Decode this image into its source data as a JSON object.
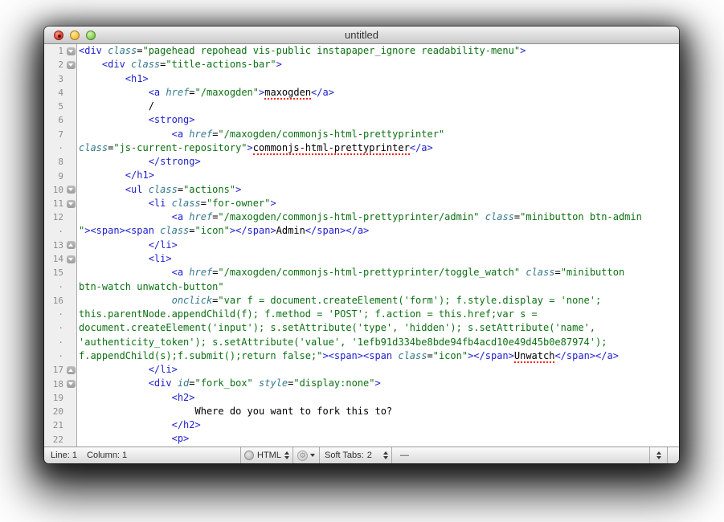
{
  "window": {
    "title": "untitled"
  },
  "colors": {
    "tag": "#1e1ece",
    "attribute": "#36798c",
    "string": "#0d7013",
    "plain": "#000000",
    "misspell_underline": "#ff241c",
    "gutter_number": "#8c8c8c"
  },
  "gutter": {
    "wrap_marker": "·"
  },
  "rows": [
    {
      "num": "1",
      "fold": "down",
      "indent": 0,
      "seg": [
        [
          "t",
          "<div "
        ],
        [
          "a",
          "class"
        ],
        [
          "p",
          "="
        ],
        [
          "s",
          "\"pagehead repohead vis-public instapaper_ignore readability-menu\""
        ],
        [
          "t",
          ">"
        ]
      ]
    },
    {
      "num": "2",
      "fold": "down",
      "indent": 4,
      "seg": [
        [
          "t",
          "<div "
        ],
        [
          "a",
          "class"
        ],
        [
          "p",
          "="
        ],
        [
          "s",
          "\"title-actions-bar\""
        ],
        [
          "t",
          ">"
        ]
      ]
    },
    {
      "num": "3",
      "fold": "",
      "indent": 8,
      "seg": [
        [
          "t",
          "<h1>"
        ]
      ]
    },
    {
      "num": "4",
      "fold": "",
      "indent": 12,
      "seg": [
        [
          "t",
          "<a "
        ],
        [
          "a",
          "href"
        ],
        [
          "p",
          "="
        ],
        [
          "s",
          "\"/maxogden\""
        ],
        [
          "t",
          ">"
        ],
        [
          "m",
          "maxogden"
        ],
        [
          "t",
          "</a>"
        ]
      ]
    },
    {
      "num": "5",
      "fold": "",
      "indent": 12,
      "seg": [
        [
          "p",
          "/"
        ]
      ]
    },
    {
      "num": "6",
      "fold": "",
      "indent": 12,
      "seg": [
        [
          "t",
          "<strong>"
        ]
      ]
    },
    {
      "num": "7",
      "fold": "",
      "indent": 16,
      "seg": [
        [
          "t",
          "<a "
        ],
        [
          "a",
          "href"
        ],
        [
          "p",
          "="
        ],
        [
          "s",
          "\"/maxogden/commonjs-html-prettyprinter\""
        ]
      ]
    },
    {
      "num": "·",
      "fold": "",
      "indent": 0,
      "seg": [
        [
          "a",
          "class"
        ],
        [
          "p",
          "="
        ],
        [
          "s",
          "\"js-current-repository\""
        ],
        [
          "t",
          ">"
        ],
        [
          "m",
          "commonjs-html-prettyprinter"
        ],
        [
          "t",
          "</a>"
        ]
      ]
    },
    {
      "num": "8",
      "fold": "",
      "indent": 12,
      "seg": [
        [
          "t",
          "</strong>"
        ]
      ]
    },
    {
      "num": "9",
      "fold": "",
      "indent": 8,
      "seg": [
        [
          "t",
          "</h1>"
        ]
      ]
    },
    {
      "num": "10",
      "fold": "down",
      "indent": 8,
      "seg": [
        [
          "t",
          "<ul "
        ],
        [
          "a",
          "class"
        ],
        [
          "p",
          "="
        ],
        [
          "s",
          "\"actions\""
        ],
        [
          "t",
          ">"
        ]
      ]
    },
    {
      "num": "11",
      "fold": "down",
      "indent": 12,
      "seg": [
        [
          "t",
          "<li "
        ],
        [
          "a",
          "class"
        ],
        [
          "p",
          "="
        ],
        [
          "s",
          "\"for-owner\""
        ],
        [
          "t",
          ">"
        ]
      ]
    },
    {
      "num": "12",
      "fold": "",
      "indent": 16,
      "seg": [
        [
          "t",
          "<a "
        ],
        [
          "a",
          "href"
        ],
        [
          "p",
          "="
        ],
        [
          "s",
          "\"/maxogden/commonjs-html-prettyprinter/admin\""
        ],
        [
          "p",
          " "
        ],
        [
          "a",
          "class"
        ],
        [
          "p",
          "="
        ],
        [
          "s",
          "\"minibutton btn-admin"
        ]
      ]
    },
    {
      "num": "·",
      "fold": "",
      "indent": 0,
      "seg": [
        [
          "s",
          "\""
        ],
        [
          "t",
          "><span><span "
        ],
        [
          "a",
          "class"
        ],
        [
          "p",
          "="
        ],
        [
          "s",
          "\"icon\""
        ],
        [
          "t",
          "></span>"
        ],
        [
          "p",
          "Admin"
        ],
        [
          "t",
          "</span></a>"
        ]
      ]
    },
    {
      "num": "13",
      "fold": "up",
      "indent": 12,
      "seg": [
        [
          "t",
          "</li>"
        ]
      ]
    },
    {
      "num": "14",
      "fold": "down",
      "indent": 12,
      "seg": [
        [
          "t",
          "<li>"
        ]
      ]
    },
    {
      "num": "15",
      "fold": "",
      "indent": 16,
      "seg": [
        [
          "t",
          "<a "
        ],
        [
          "a",
          "href"
        ],
        [
          "p",
          "="
        ],
        [
          "s",
          "\"/maxogden/commonjs-html-prettyprinter/toggle_watch\""
        ],
        [
          "p",
          " "
        ],
        [
          "a",
          "class"
        ],
        [
          "p",
          "="
        ],
        [
          "s",
          "\"minibutton"
        ]
      ]
    },
    {
      "num": "·",
      "fold": "",
      "indent": 0,
      "seg": [
        [
          "s",
          "btn-watch unwatch-button\""
        ]
      ]
    },
    {
      "num": "16",
      "fold": "",
      "indent": 16,
      "seg": [
        [
          "a",
          "onclick"
        ],
        [
          "p",
          "="
        ],
        [
          "s",
          "\"var f = document.createElement('form'); f.style.display = 'none';"
        ]
      ]
    },
    {
      "num": "·",
      "fold": "",
      "indent": 0,
      "seg": [
        [
          "s",
          "this.parentNode.appendChild(f); f.method = 'POST'; f.action = this.href;var s ="
        ]
      ]
    },
    {
      "num": "·",
      "fold": "",
      "indent": 0,
      "seg": [
        [
          "s",
          "document.createElement('input'); s.setAttribute('type', 'hidden'); s.setAttribute('name',"
        ]
      ]
    },
    {
      "num": "·",
      "fold": "",
      "indent": 0,
      "seg": [
        [
          "s",
          "'authenticity_token'); s.setAttribute('value', '1efb91d334be8bde94fb4acd10e49d45b0e87974');"
        ]
      ]
    },
    {
      "num": "·",
      "fold": "",
      "indent": 0,
      "seg": [
        [
          "s",
          "f.appendChild(s);f.submit();return false;\""
        ],
        [
          "t",
          "><span><span "
        ],
        [
          "a",
          "class"
        ],
        [
          "p",
          "="
        ],
        [
          "s",
          "\"icon\""
        ],
        [
          "t",
          "></span>"
        ],
        [
          "m",
          "Unwatch"
        ],
        [
          "t",
          "</span></a>"
        ]
      ]
    },
    {
      "num": "17",
      "fold": "up",
      "indent": 12,
      "seg": [
        [
          "t",
          "</li>"
        ]
      ]
    },
    {
      "num": "18",
      "fold": "down",
      "indent": 12,
      "seg": [
        [
          "t",
          "<div "
        ],
        [
          "a",
          "id"
        ],
        [
          "p",
          "="
        ],
        [
          "s",
          "\"fork_box\""
        ],
        [
          "p",
          " "
        ],
        [
          "a",
          "style"
        ],
        [
          "p",
          "="
        ],
        [
          "s",
          "\"display:none\""
        ],
        [
          "t",
          ">"
        ]
      ]
    },
    {
      "num": "19",
      "fold": "",
      "indent": 16,
      "seg": [
        [
          "t",
          "<h2>"
        ]
      ]
    },
    {
      "num": "20",
      "fold": "",
      "indent": 20,
      "seg": [
        [
          "p",
          "Where do you want to fork this to?"
        ]
      ]
    },
    {
      "num": "21",
      "fold": "",
      "indent": 16,
      "seg": [
        [
          "t",
          "</h2>"
        ]
      ]
    },
    {
      "num": "22",
      "fold": "",
      "indent": 16,
      "seg": [
        [
          "t",
          "<p>"
        ]
      ]
    }
  ],
  "statusbar": {
    "line_label": "Line: 1",
    "column_label": "Column: 1",
    "language": "HTML",
    "gear_glyph": "⚙",
    "soft_tabs_label": "Soft Tabs:",
    "soft_tabs_value": "2",
    "symbol_placeholder": "—"
  }
}
